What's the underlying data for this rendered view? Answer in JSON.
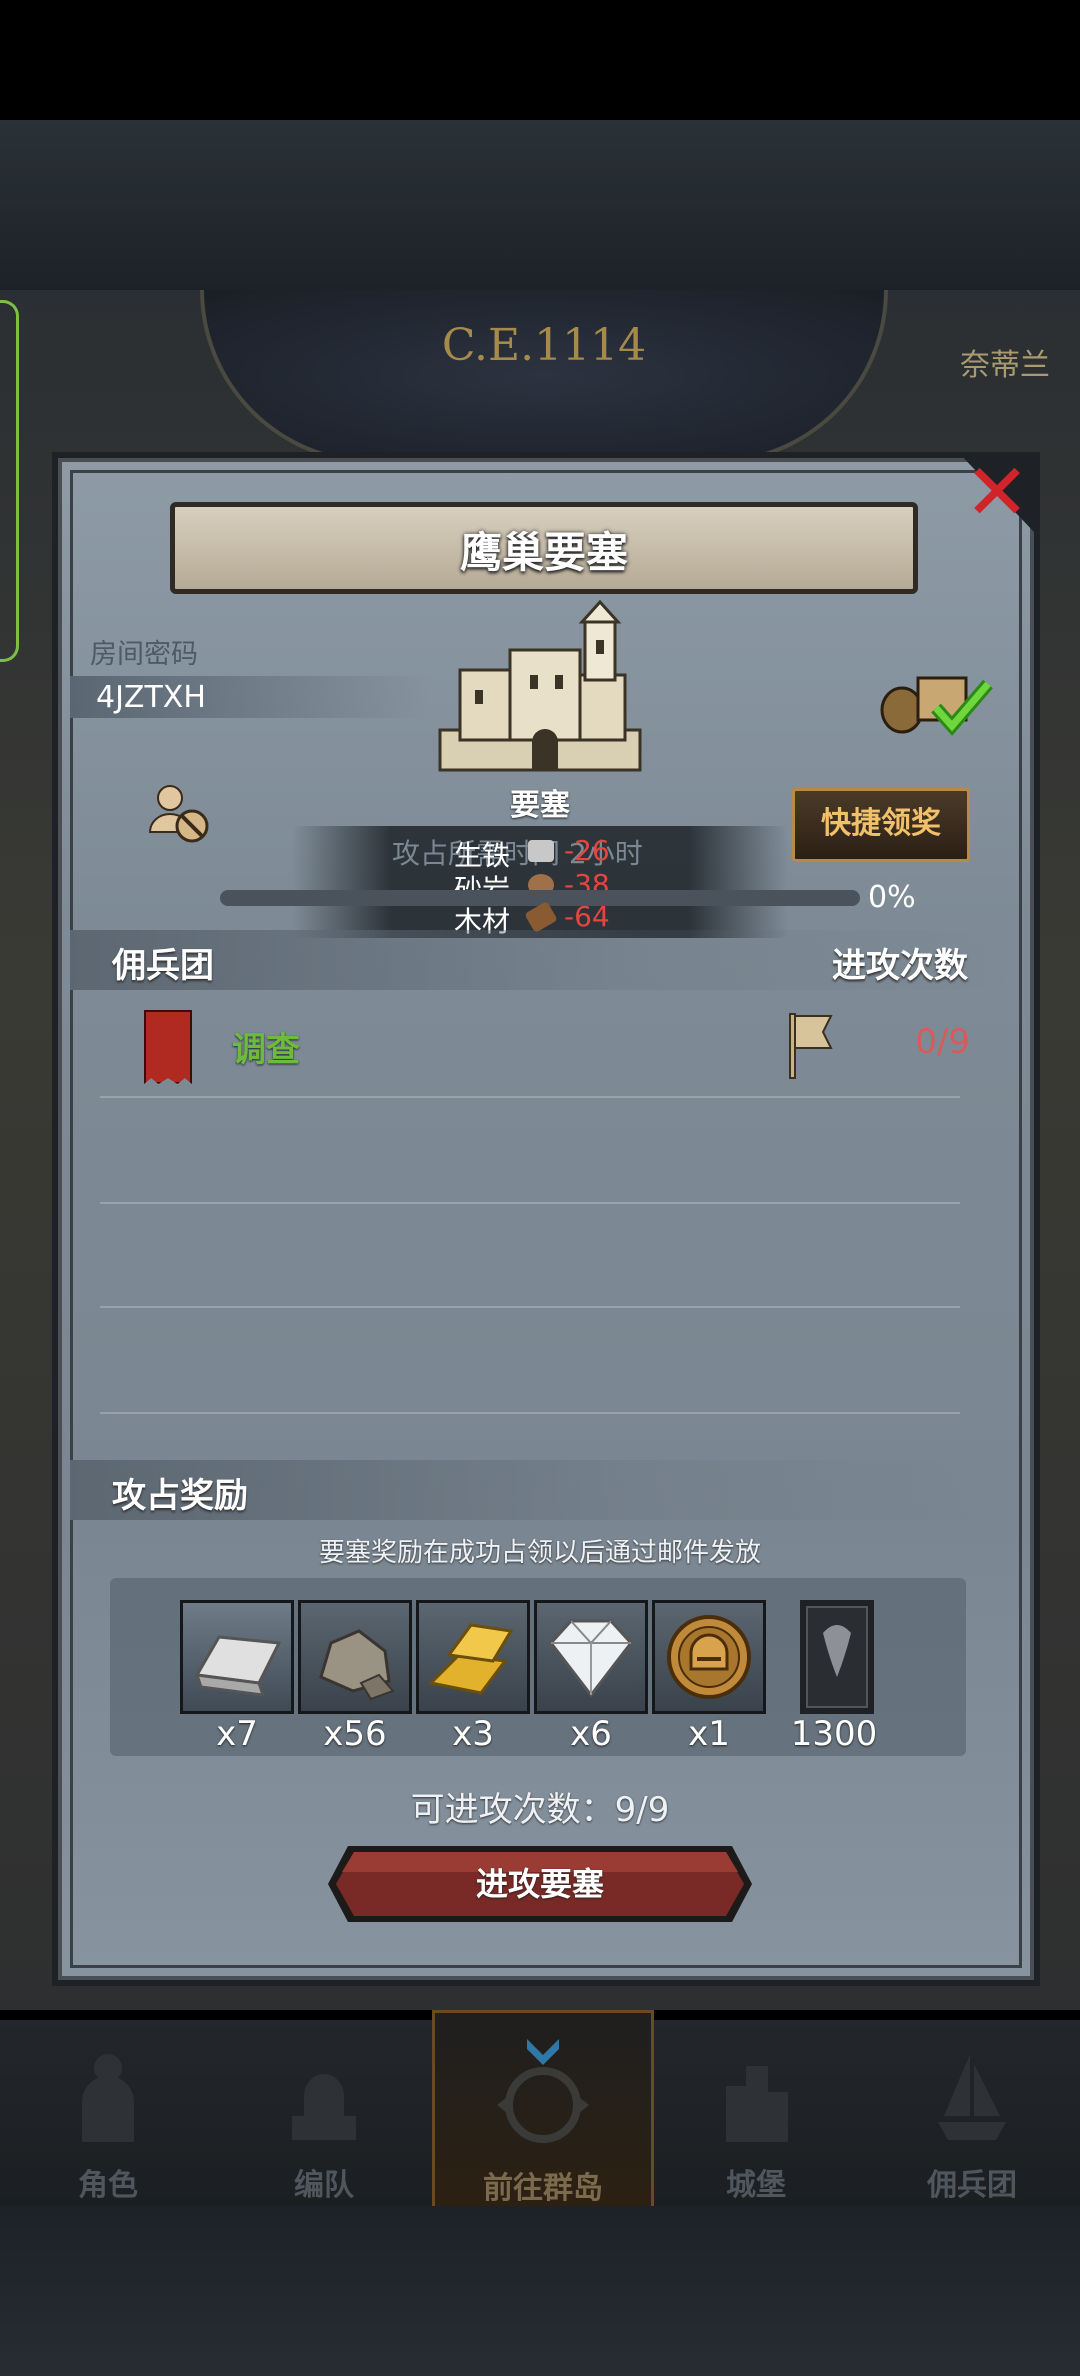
{
  "header": {
    "era": "C.E.1114",
    "era_right": "奈蒂兰"
  },
  "dialog": {
    "title": "鹰巢要塞",
    "room_label": "房间密码",
    "room_code": "4JZTXH",
    "fortress_label": "要塞",
    "quick_claim_button": "快捷领奖",
    "capture_time_ghost": "攻占所需时间 2小时",
    "resources": [
      {
        "name": "生铁",
        "value": "-26",
        "icon": "iron-icon",
        "color": "#c8c8c8"
      },
      {
        "name": "砂岩",
        "value": "-38",
        "icon": "sandstone-icon",
        "color": "#a07048"
      },
      {
        "name": "木材",
        "value": "-64",
        "icon": "wood-icon",
        "color": "#8a5a32"
      }
    ],
    "progress": {
      "value": 0,
      "label": "0%"
    },
    "mercenary_header": "佣兵团",
    "attack_count_header": "进攻次数",
    "mercenaries": [
      {
        "name": "调查",
        "count": "0/9",
        "banner_color": "#b02a22"
      }
    ],
    "rewards_header": "攻占奖励",
    "reward_note": "要塞奖励在成功占领以后通过邮件发放",
    "rewards": [
      {
        "icon": "iron-bar-icon",
        "count": "x7"
      },
      {
        "icon": "stone-icon",
        "count": "x56"
      },
      {
        "icon": "gold-bar-icon",
        "count": "x3"
      },
      {
        "icon": "diamond-icon",
        "count": "x6"
      },
      {
        "icon": "helmet-coin-icon",
        "count": "x1"
      },
      {
        "icon": "banner-icon",
        "count": "1300"
      }
    ],
    "attempts_text": "可进攻次数：9/9",
    "attack_button": "进攻要塞"
  },
  "bottom_nav": [
    {
      "label": "角色",
      "icon": "knight-icon",
      "active": false
    },
    {
      "label": "编队",
      "icon": "formation-icon",
      "active": false
    },
    {
      "label": "前往群岛",
      "icon": "compass-icon",
      "active": true
    },
    {
      "label": "城堡",
      "icon": "castle-icon",
      "active": false
    },
    {
      "label": "佣兵团",
      "icon": "ship-icon",
      "active": false
    }
  ]
}
